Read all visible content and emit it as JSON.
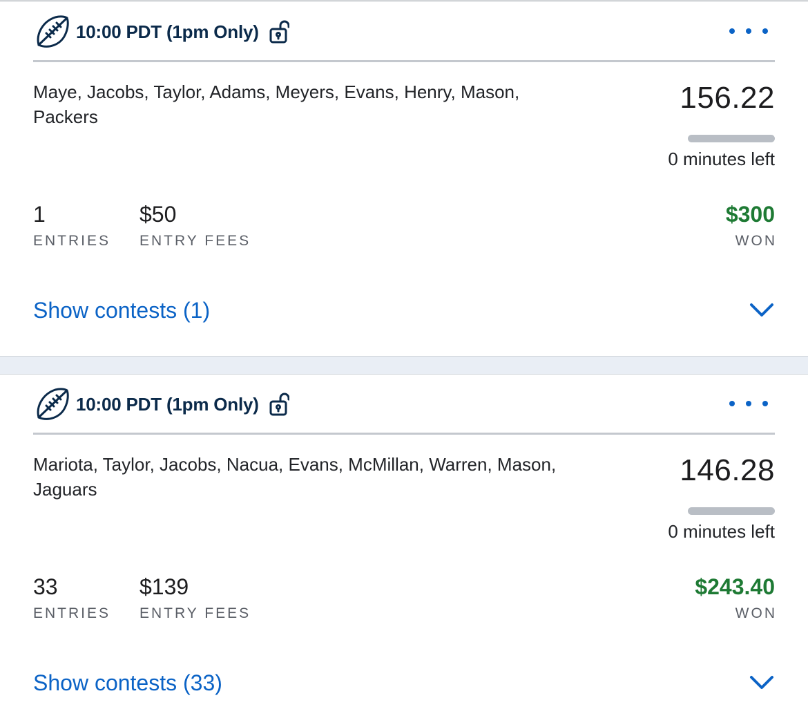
{
  "colors": {
    "accent": "#0b63c6",
    "won": "#1e7a34",
    "title": "#0b2a4a"
  },
  "cards": [
    {
      "title": "10:00 PDT (1pm Only)",
      "players": "Maye, Jacobs, Taylor, Adams, Meyers, Evans, Henry, Mason, Packers",
      "score": "156.22",
      "progress": 0,
      "time_left": "0 minutes left",
      "entries_value": "1",
      "entries_label": "ENTRIES",
      "fees_value": "$50",
      "fees_label": "ENTRY FEES",
      "won_value": "$300",
      "won_label": "WON",
      "show_contests": "Show contests (1)"
    },
    {
      "title": "10:00 PDT (1pm Only)",
      "players": "Mariota, Taylor, Jacobs, Nacua, Evans, McMillan, Warren, Mason, Jaguars",
      "score": "146.28",
      "progress": 0,
      "time_left": "0 minutes left",
      "entries_value": "33",
      "entries_label": "ENTRIES",
      "fees_value": "$139",
      "fees_label": "ENTRY FEES",
      "won_value": "$243.40",
      "won_label": "WON",
      "show_contests": "Show contests (33)"
    }
  ],
  "icons": {
    "sport": "football-icon",
    "lock": "unlocked-padlock-icon",
    "more": "more-options-icon",
    "expand": "chevron-down-icon"
  }
}
